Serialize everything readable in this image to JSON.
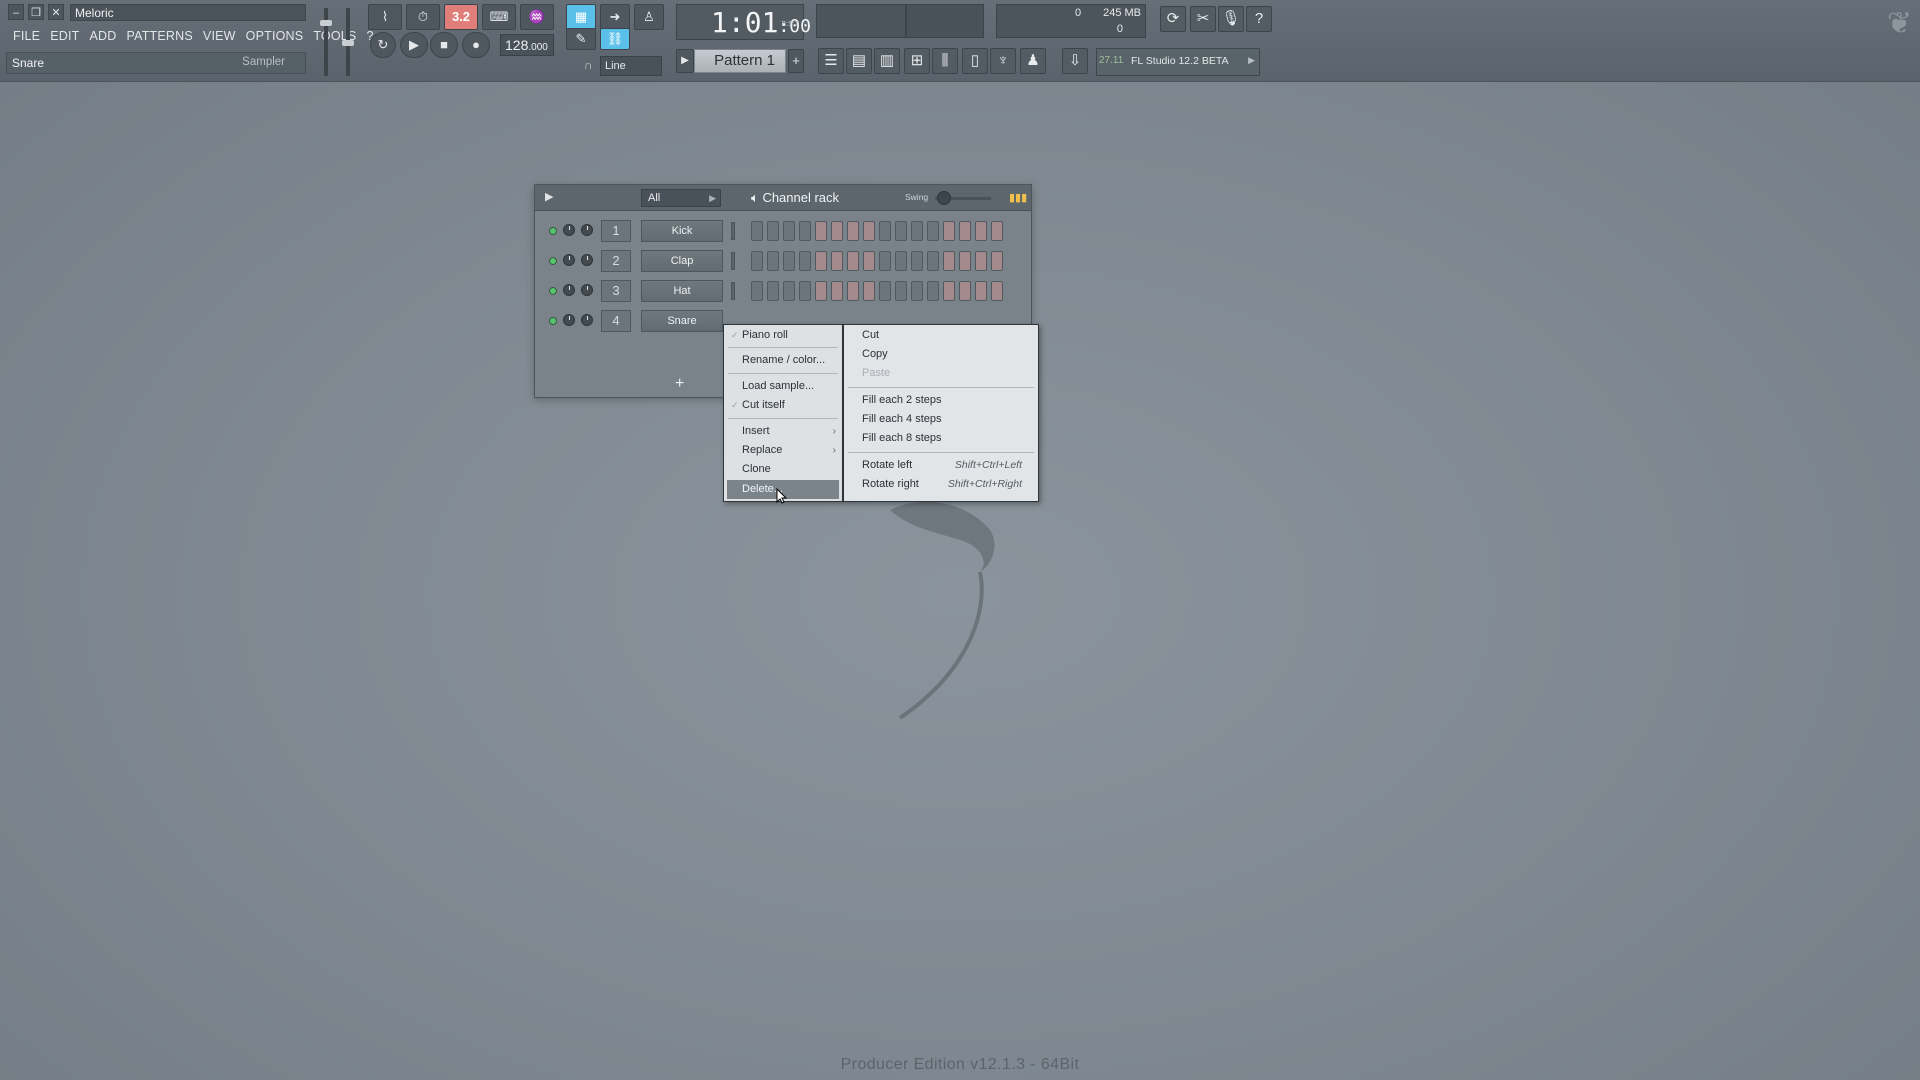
{
  "window": {
    "project_title": "Meloric",
    "minimize_icon": "minimize-icon",
    "restore_icon": "restore-icon",
    "close_icon": "close-icon"
  },
  "menu": [
    "FILE",
    "EDIT",
    "ADD",
    "PATTERNS",
    "VIEW",
    "OPTIONS",
    "TOOLS",
    "?"
  ],
  "hint_bar": {
    "name": "Snare",
    "type": "Sampler"
  },
  "transport": {
    "mode_value": "3.2",
    "tempo": "128",
    "tempo_decimal": ".000",
    "time_main": "1:01",
    "time_sub": ":00",
    "time_format": "B:S:T",
    "snap": "Line",
    "pattern": "Pattern 1"
  },
  "monitor": {
    "cpu": "0",
    "memory": "245 MB",
    "polyphony": "0"
  },
  "news": {
    "version": "27.11",
    "text": "FL Studio 12.2 BETA"
  },
  "channel_rack": {
    "filter": "All",
    "title": "Channel rack",
    "swing_label": "Swing",
    "add_symbol": "+",
    "channels": [
      {
        "num": "1",
        "name": "Kick"
      },
      {
        "num": "2",
        "name": "Clap"
      },
      {
        "num": "3",
        "name": "Hat"
      },
      {
        "num": "4",
        "name": "Snare"
      }
    ]
  },
  "context_menu": {
    "main": [
      {
        "label": "Piano roll",
        "checked": true
      },
      {
        "label": "Rename / color..."
      },
      {
        "label": "Load sample..."
      },
      {
        "label": "Cut itself",
        "checked": true
      },
      {
        "label": "Insert",
        "submenu": true
      },
      {
        "label": "Replace",
        "submenu": true
      },
      {
        "label": "Clone"
      },
      {
        "label": "Delete...",
        "highlighted": true
      }
    ],
    "sub": [
      {
        "label": "Cut"
      },
      {
        "label": "Copy"
      },
      {
        "label": "Paste",
        "disabled": true
      },
      {
        "label": "Fill each 2 steps"
      },
      {
        "label": "Fill each 4 steps"
      },
      {
        "label": "Fill each 8 steps"
      },
      {
        "label": "Rotate left",
        "shortcut": "Shift+Ctrl+Left"
      },
      {
        "label": "Rotate right",
        "shortcut": "Shift+Ctrl+Right"
      }
    ]
  },
  "edition": "Producer Edition v12.1.3 - 64Bit",
  "colors": {
    "background": "#7f8890",
    "toolbar": "#5a636b",
    "led_on": "#55c36b",
    "step_red": "#a48a8d",
    "mode_active": "#e07f7a",
    "pat_active": "#5bc0e9"
  }
}
